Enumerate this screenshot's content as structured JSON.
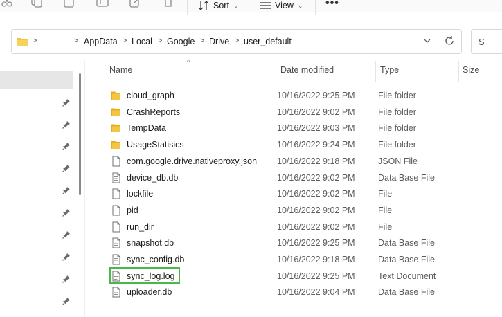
{
  "toolbar": {
    "sort_label": "Sort",
    "view_label": "View",
    "more_label": "•••"
  },
  "address": {
    "root_chevron": ">",
    "crumbs": [
      "AppData",
      "Local",
      "Google",
      "Drive",
      "user_default"
    ],
    "separator": ">"
  },
  "search": {
    "placeholder": "S"
  },
  "columns": {
    "name": "Name",
    "date": "Date modified",
    "type": "Type",
    "size": "Size"
  },
  "files": [
    {
      "name": "cloud_graph",
      "date": "10/16/2022 9:25 PM",
      "type": "File folder",
      "icon": "folder-icon"
    },
    {
      "name": "CrashReports",
      "date": "10/16/2022 9:02 PM",
      "type": "File folder",
      "icon": "folder-icon"
    },
    {
      "name": "TempData",
      "date": "10/16/2022 9:03 PM",
      "type": "File folder",
      "icon": "folder-icon"
    },
    {
      "name": "UsageStatisics",
      "date": "10/16/2022 9:24 PM",
      "type": "File folder",
      "icon": "folder-icon"
    },
    {
      "name": "com.google.drive.nativeproxy.json",
      "date": "10/16/2022 9:18 PM",
      "type": "JSON File",
      "icon": "file-icon"
    },
    {
      "name": "device_db.db",
      "date": "10/16/2022 9:02 PM",
      "type": "Data Base File",
      "icon": "database-file-icon"
    },
    {
      "name": "lockfile",
      "date": "10/16/2022 9:02 PM",
      "type": "File",
      "icon": "file-icon"
    },
    {
      "name": "pid",
      "date": "10/16/2022 9:02 PM",
      "type": "File",
      "icon": "file-icon"
    },
    {
      "name": "run_dir",
      "date": "10/16/2022 9:02 PM",
      "type": "File",
      "icon": "file-icon"
    },
    {
      "name": "snapshot.db",
      "date": "10/16/2022 9:25 PM",
      "type": "Data Base File",
      "icon": "database-file-icon"
    },
    {
      "name": "sync_config.db",
      "date": "10/16/2022 9:18 PM",
      "type": "Data Base File",
      "icon": "database-file-icon"
    },
    {
      "name": "sync_log.log",
      "date": "10/16/2022 9:25 PM",
      "type": "Text Document",
      "icon": "text-file-icon"
    },
    {
      "name": "uploader.db",
      "date": "10/16/2022 9:04 PM",
      "type": "Data Base File",
      "icon": "database-file-icon"
    }
  ],
  "colors": {
    "folder": "#f4c542",
    "highlight": "#4bb74b",
    "selection": "#e6e6e6"
  }
}
